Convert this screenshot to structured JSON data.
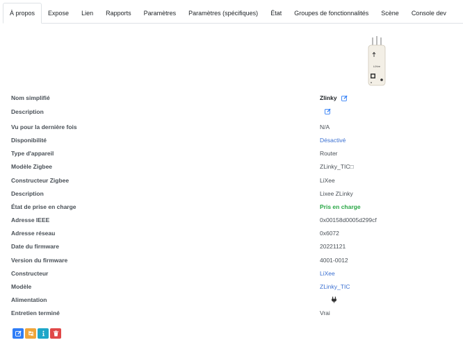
{
  "tabs": [
    {
      "label": "À propos",
      "active": true
    },
    {
      "label": "Expose"
    },
    {
      "label": "Lien"
    },
    {
      "label": "Rapports"
    },
    {
      "label": "Paramètres"
    },
    {
      "label": "Paramètres (spécifiques)"
    },
    {
      "label": "État"
    },
    {
      "label": "Groupes de fonctionnalités"
    },
    {
      "label": "Scène"
    },
    {
      "label": "Console dev"
    }
  ],
  "device": {
    "image_icon": "zlinky-device-image",
    "image_caption": "LiXee"
  },
  "info": {
    "nom_simplifie": {
      "label": "Nom simplifié",
      "value": "Zlinky"
    },
    "description": {
      "label": "Description"
    },
    "vu": {
      "label": "Vu pour la dernière fois",
      "value": "N/A"
    },
    "disponibilite": {
      "label": "Disponibilité",
      "value": "Désactivé"
    },
    "type": {
      "label": "Type d'appareil",
      "value": "Router"
    },
    "modele_zigbee": {
      "label": "Modèle Zigbee",
      "value": "ZLinky_TIC□"
    },
    "constructeur_zigbee": {
      "label": "Constructeur Zigbee",
      "value": "LiXee"
    },
    "description2": {
      "label": "Description",
      "value": "Lixee ZLinky"
    },
    "prise_en_charge": {
      "label": "État de prise en charge",
      "value": "Pris en charge"
    },
    "ieee": {
      "label": "Adresse IEEE",
      "value": "0x00158d0005d299cf"
    },
    "reseau": {
      "label": "Adresse réseau",
      "value": "0x6072"
    },
    "date_firmware": {
      "label": "Date du firmware",
      "value": "20221121"
    },
    "version_firmware": {
      "label": "Version du firmware",
      "value": "4001-0012"
    },
    "constructeur": {
      "label": "Constructeur",
      "value": "LiXee"
    },
    "modele": {
      "label": "Modèle",
      "value": "ZLinky_TIC"
    },
    "alimentation": {
      "label": "Alimentation",
      "icon": "plug-icon"
    },
    "entretien": {
      "label": "Entretien terminé",
      "value": "Vrai"
    }
  },
  "actions": [
    {
      "name": "edit-button",
      "icon": "edit-icon",
      "color": "#2f7df6"
    },
    {
      "name": "reconfigure-button",
      "icon": "swap-icon",
      "color": "#f0a53a"
    },
    {
      "name": "interview-button",
      "icon": "info-icon",
      "color": "#1ea6c8"
    },
    {
      "name": "delete-button",
      "icon": "trash-icon",
      "color": "#e04848"
    }
  ]
}
